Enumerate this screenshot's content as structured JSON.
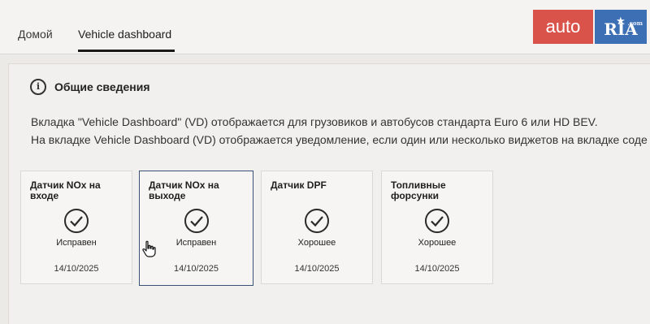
{
  "tabs": {
    "home": "Домой",
    "vehicle_dashboard": "Vehicle dashboard"
  },
  "section": {
    "icon": "info-icon",
    "title": "Общие сведения",
    "desc_line1": "Вкладка \"Vehicle Dashboard\" (VD) отображается для грузовиков и автобусов стандарта Euro 6 или HD BEV.",
    "desc_line2": "На вкладке Vehicle Dashboard (VD) отображается уведомление, если один или несколько виджетов на вкладке соде"
  },
  "cards": [
    {
      "title": "Датчик NOx на входе",
      "status": "Исправен",
      "date": "14/10/2025",
      "icon": "check-circle-icon"
    },
    {
      "title": "Датчик NOx на выходе",
      "status": "Исправен",
      "date": "14/10/2025",
      "icon": "check-circle-icon",
      "selected": true
    },
    {
      "title": "Датчик DPF",
      "status": "Хорошее",
      "date": "14/10/2025",
      "icon": "check-circle-icon"
    },
    {
      "title": "Топливные форсунки",
      "status": "Хорошее",
      "date": "14/10/2025",
      "icon": "check-circle-icon"
    }
  ],
  "watermark": {
    "auto": "auto",
    "ria": "RIA",
    "domain": ".com"
  },
  "colors": {
    "logo_red": "#d9534a",
    "logo_blue": "#3d6fb5",
    "selected_border": "#3b5277"
  }
}
